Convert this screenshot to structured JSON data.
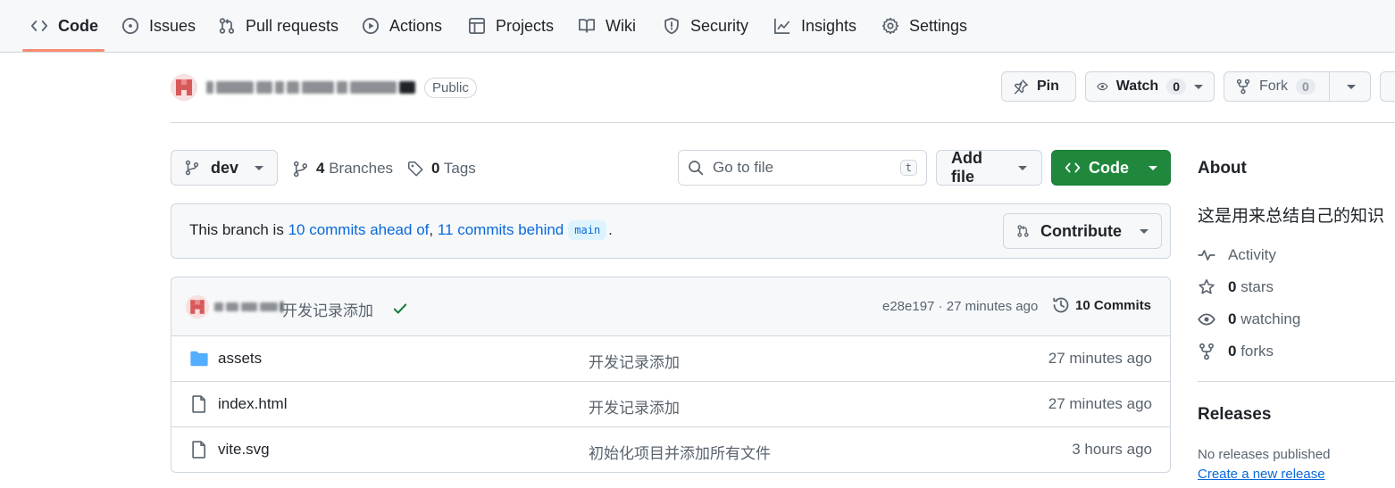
{
  "nav": {
    "tabs": [
      {
        "label": "Code",
        "icon": "code-icon"
      },
      {
        "label": "Issues",
        "icon": "issue-icon"
      },
      {
        "label": "Pull requests",
        "icon": "pull-request-icon"
      },
      {
        "label": "Actions",
        "icon": "play-icon"
      },
      {
        "label": "Projects",
        "icon": "table-icon"
      },
      {
        "label": "Wiki",
        "icon": "book-icon"
      },
      {
        "label": "Security",
        "icon": "shield-icon"
      },
      {
        "label": "Insights",
        "icon": "graph-icon"
      },
      {
        "label": "Settings",
        "icon": "gear-icon"
      }
    ],
    "active": "Code"
  },
  "repo": {
    "visibility": "Public",
    "pin_label": "Pin",
    "watch_label": "Watch",
    "watch_count": "0",
    "fork_label": "Fork",
    "fork_count": "0"
  },
  "branchbar": {
    "branch": "dev",
    "branches_count": "4",
    "branches_label": "Branches",
    "tags_count": "0",
    "tags_label": "Tags",
    "search_placeholder": "Go to file",
    "search_kbd": "t",
    "add_file_label": "Add file",
    "code_label": "Code"
  },
  "branch_info": {
    "prefix": "This branch is",
    "ahead": "10 commits ahead of",
    "sep": ",",
    "behind": "11 commits behind",
    "base": "main",
    "suffix": ".",
    "contribute_label": "Contribute"
  },
  "latest_commit": {
    "message": "开发记录添加",
    "sha_time": "e28e197 · 27 minutes ago",
    "commits_label": "10 Commits"
  },
  "files": [
    {
      "name": "assets",
      "type": "folder",
      "message": "开发记录添加",
      "time": "27 minutes ago"
    },
    {
      "name": "index.html",
      "type": "file",
      "message": "开发记录添加",
      "time": "27 minutes ago"
    },
    {
      "name": "vite.svg",
      "type": "file",
      "message": "初始化项目并添加所有文件",
      "time": "3 hours ago"
    }
  ],
  "about": {
    "title": "About",
    "description": "这是用来总结自己的知识",
    "activity_label": "Activity",
    "stars_count": "0",
    "stars_label": "stars",
    "watching_count": "0",
    "watching_label": "watching",
    "forks_count": "0",
    "forks_label": "forks"
  },
  "releases": {
    "title": "Releases",
    "none_text": "No releases published",
    "create_link": "Create a new release"
  },
  "colors": {
    "accent_green": "#1f883d",
    "link_blue": "#0969da",
    "tab_underline": "#fd8c73",
    "folder_blue": "#54aeff"
  }
}
